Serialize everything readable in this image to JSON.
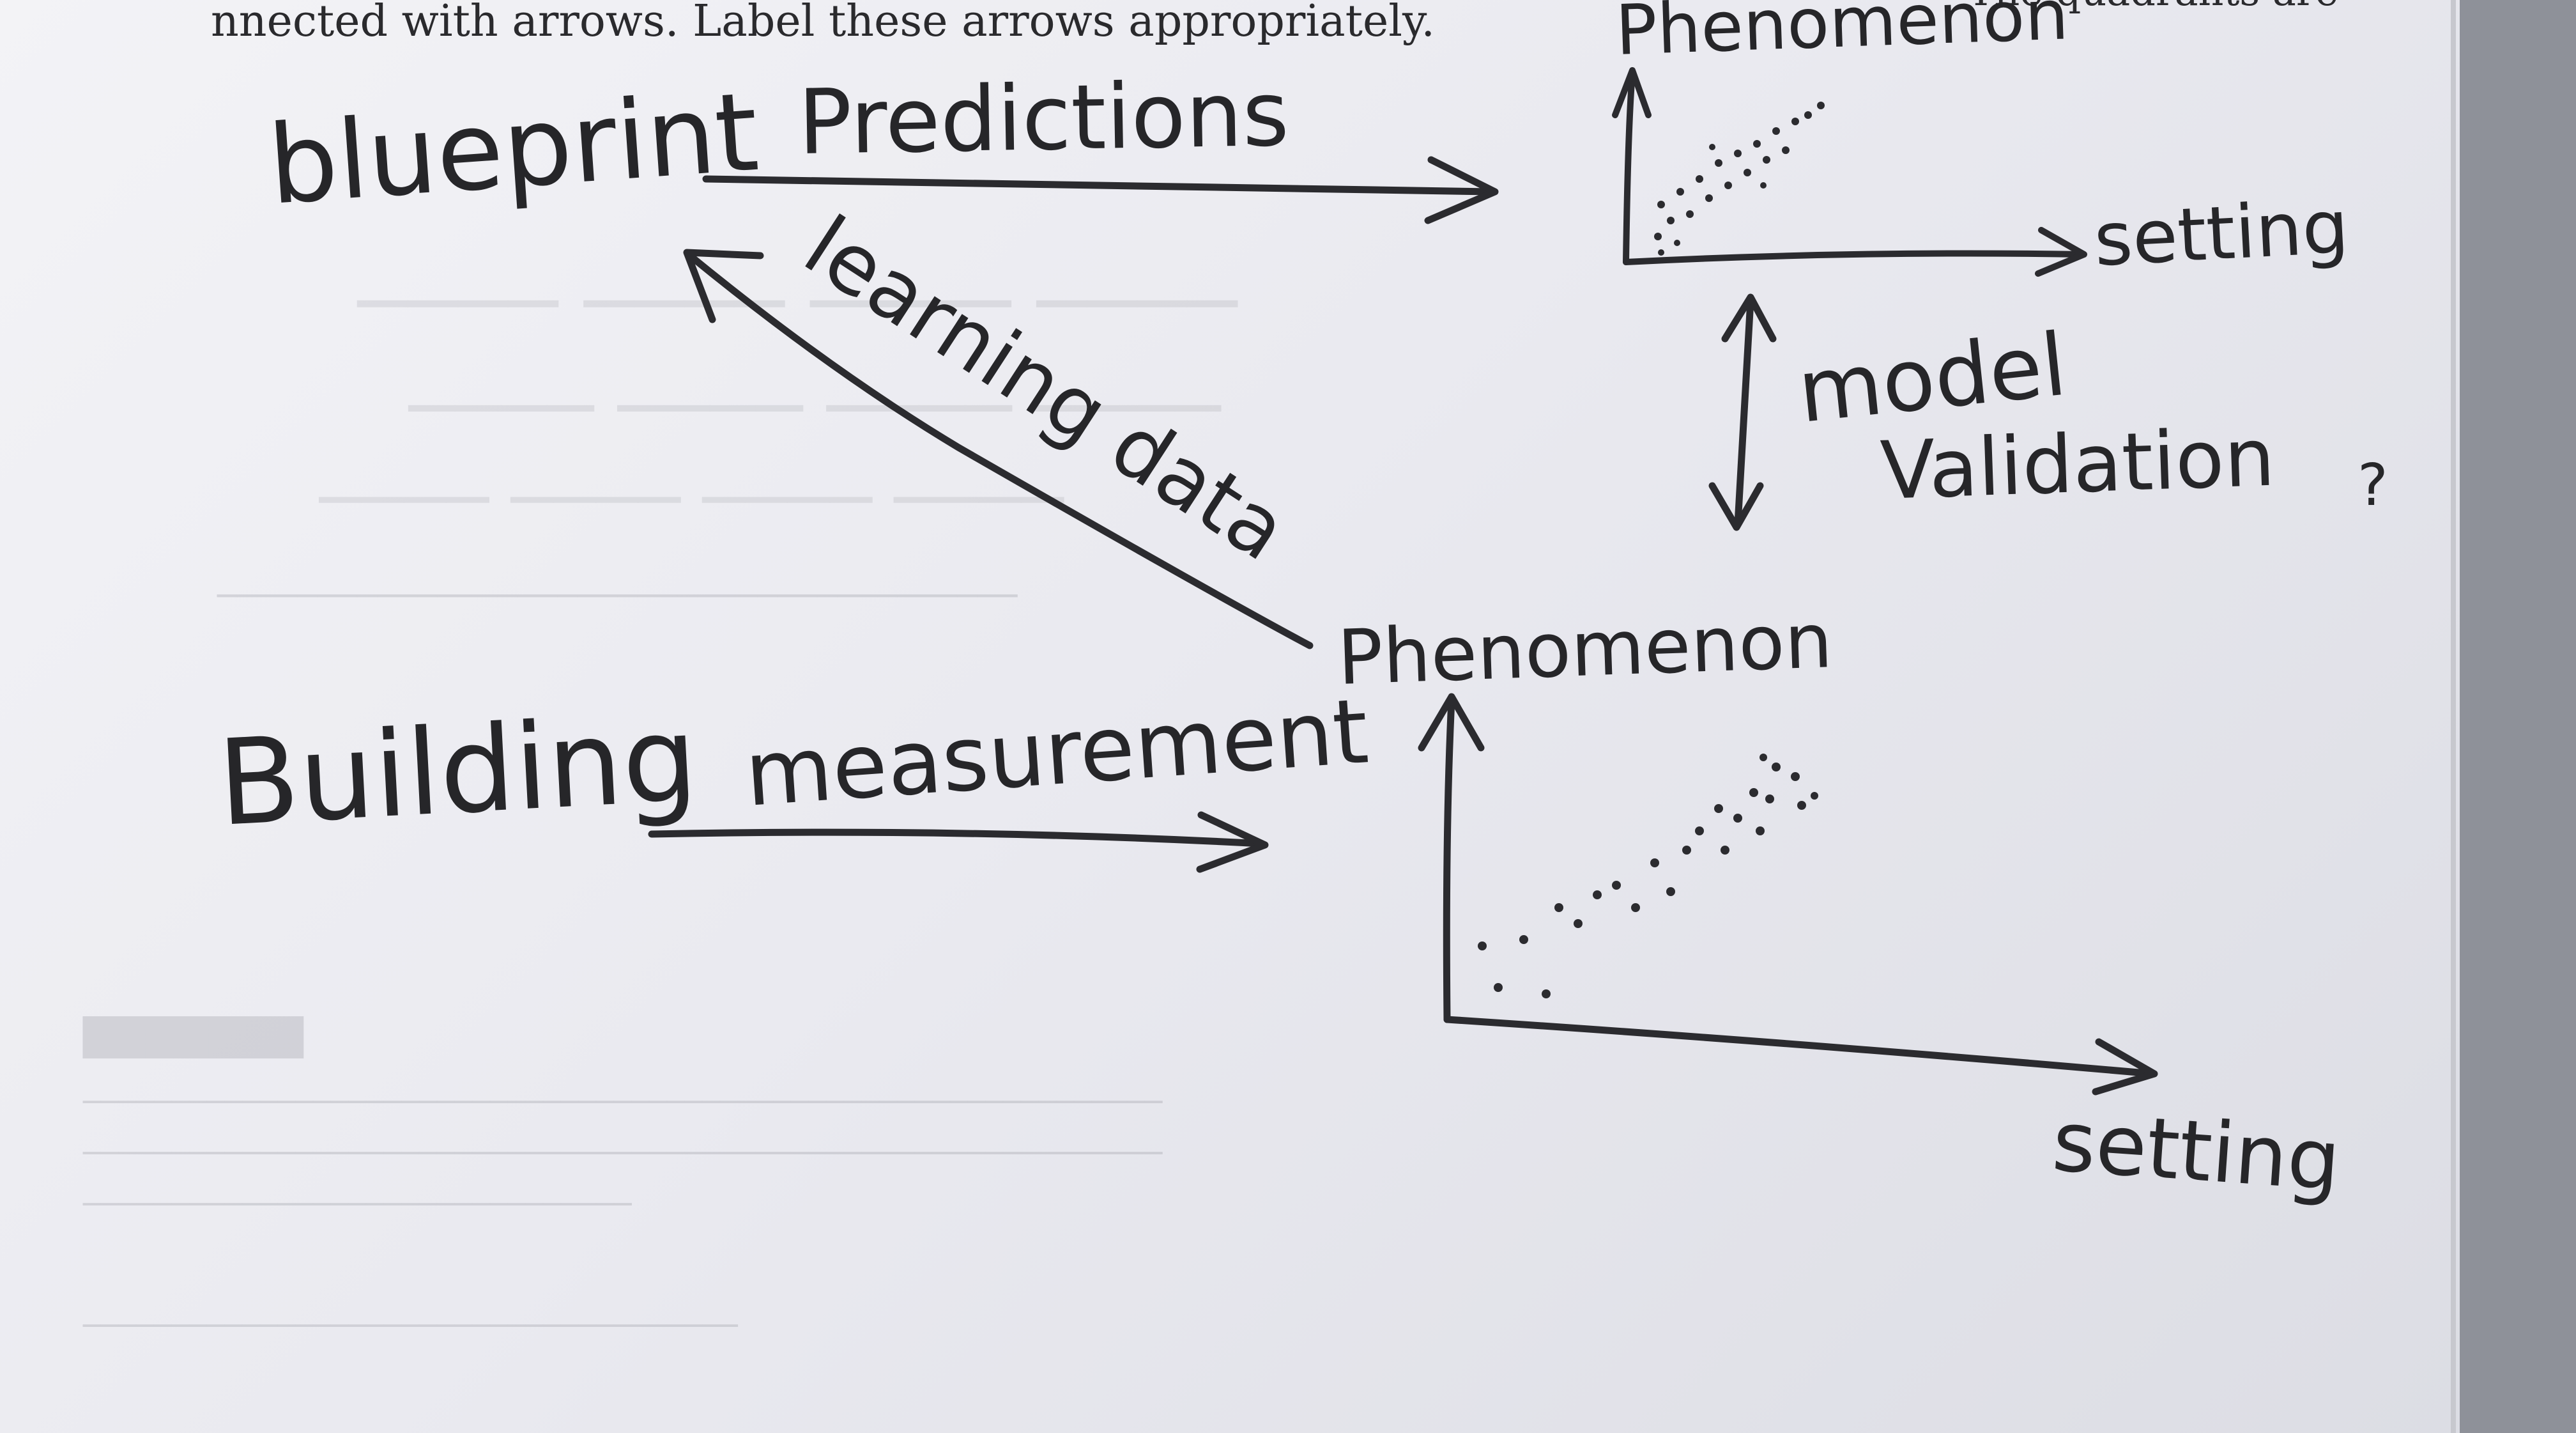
{
  "printed_text": "nnected with arrows. Label these arrows appropriately.",
  "printed_text_right": "The quadrants are",
  "nodes": {
    "blueprint": "blueprint",
    "building": "Building"
  },
  "arrows": {
    "predictions": "Predictions",
    "learning_data": "learning data",
    "measurement": "measurement",
    "model_validation_line1": "model",
    "model_validation_line2": "Validation"
  },
  "top_plot": {
    "y_label": "Phenomenon",
    "x_label": "setting"
  },
  "bottom_plot": {
    "y_label": "Phenomenon",
    "x_label": "setting"
  },
  "margin_mark": "?",
  "colors": {
    "ink": "#2b2b2f",
    "paper": "#eeeef2",
    "background": "#8e9199"
  }
}
